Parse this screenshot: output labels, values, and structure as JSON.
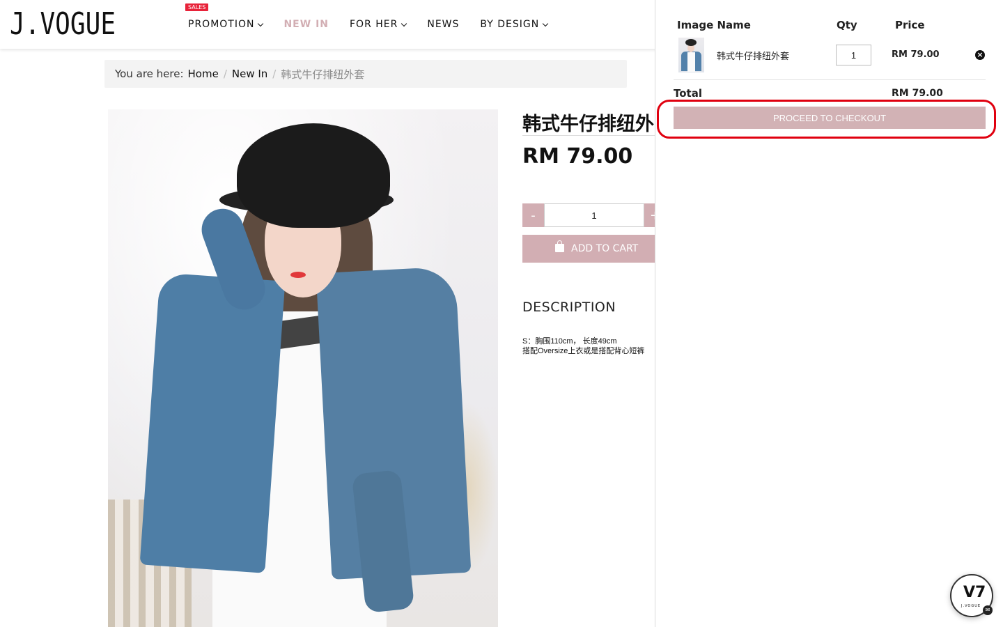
{
  "header": {
    "logo": "J.VOGUE",
    "nav": [
      {
        "label": "PROMOTION",
        "badge": "SALES",
        "has_dropdown": true
      },
      {
        "label": "NEW IN",
        "active": true
      },
      {
        "label": "FOR HER",
        "has_dropdown": true
      },
      {
        "label": "NEWS"
      },
      {
        "label": "BY DESIGN",
        "has_dropdown": true
      }
    ]
  },
  "breadcrumb": {
    "prefix": "You are here:",
    "items": [
      "Home",
      "New In"
    ],
    "current": "韩式牛仔排纽外套"
  },
  "product": {
    "title": "韩式牛仔排纽外",
    "price": "RM 79.00",
    "quantity": "1",
    "minus": "-",
    "plus": "+",
    "add_to_cart": "ADD TO CART",
    "description_heading": "DESCRIPTION",
    "description_lines": [
      "S：胸围110cm， 长度49cm",
      "搭配Oversize上衣或是搭配背心短裤"
    ]
  },
  "cart": {
    "columns": {
      "image_name": "Image Name",
      "qty": "Qty",
      "price": "Price"
    },
    "items": [
      {
        "name": "韩式牛仔排纽外套",
        "qty": "1",
        "price": "RM 79.00"
      }
    ],
    "total_label": "Total",
    "total_value": "RM 79.00",
    "checkout": "PROCEED TO CHECKOUT"
  },
  "chat": {
    "logo": "V7",
    "sub": "J.VOGUE",
    "icon": "messenger-icon"
  },
  "colors": {
    "accent": "#d2aeb3",
    "highlight": "#e0000f",
    "sales_badge": "#e8233a"
  }
}
